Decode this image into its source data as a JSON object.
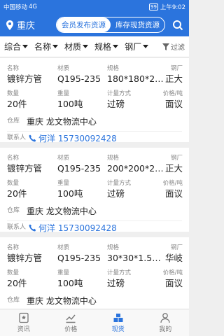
{
  "statusbar": {
    "carrier": "中国移动",
    "network": "4G",
    "battery": "99",
    "time": "上午9:02"
  },
  "header": {
    "city": "重庆",
    "seg_active": "会员发布资源",
    "seg_inactive": "库存现货资源"
  },
  "filters": {
    "items": [
      "综合",
      "名称",
      "材质",
      "规格",
      "钢厂"
    ],
    "filter_label": "过滤"
  },
  "labels": {
    "name": "名称",
    "material": "材质",
    "spec": "规格",
    "mill": "钢厂",
    "qty": "数量",
    "weight": "重量",
    "method": "计量方式",
    "price": "价格/吨",
    "warehouse": "仓库",
    "contact": "联系人"
  },
  "cards": [
    {
      "name": "镀锌方管",
      "material": "Q195-235",
      "spec": "180*180*2…",
      "mill": "正大",
      "qty": "20件",
      "weight": "100吨",
      "method": "过磅",
      "price": "面议",
      "warehouse": "重庆 龙文物流中心",
      "contact": "何洋 15730092428"
    },
    {
      "name": "镀锌方管",
      "material": "Q195-235",
      "spec": "200*200*2…",
      "mill": "正大",
      "qty": "20件",
      "weight": "100吨",
      "method": "过磅",
      "price": "面议",
      "warehouse": "重庆 龙文物流中心",
      "contact": "何洋 15730092428"
    },
    {
      "name": "镀锌方管",
      "material": "Q195-235",
      "spec": "30*30*1.5…",
      "mill": "华岐",
      "qty": "20件",
      "weight": "100吨",
      "method": "过磅",
      "price": "面议",
      "warehouse": "重庆 龙文物流中心",
      "contact": ""
    }
  ],
  "tabs": {
    "news": "资讯",
    "price": "价格",
    "spot": "现货",
    "mine": "我的"
  },
  "colors": {
    "accent": "#2b74dd"
  }
}
